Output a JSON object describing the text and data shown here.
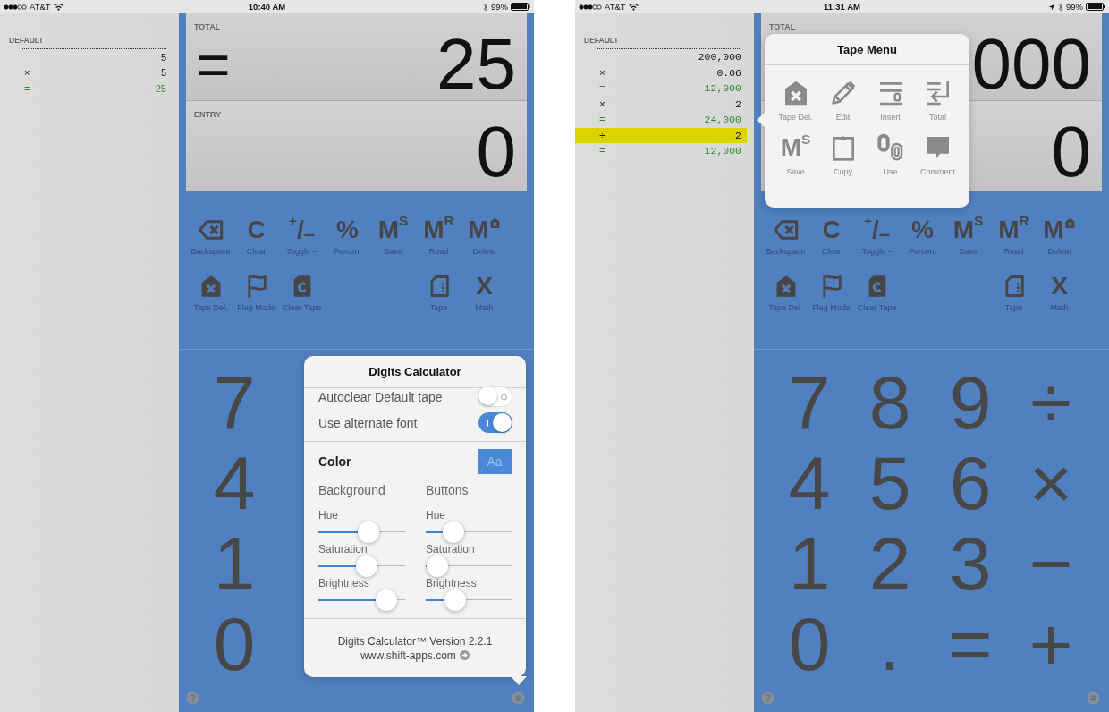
{
  "screens": [
    {
      "status_bar": {
        "carrier": "AT&T",
        "time": "10:40 AM",
        "battery": "99%",
        "location_services": false
      },
      "tape": {
        "title": "DEFAULT",
        "rows": [
          {
            "value": "5",
            "kind": "entry",
            "selected": false
          },
          {
            "operator": "×",
            "value": "5",
            "kind": "entry",
            "selected": false
          },
          {
            "operator": "=",
            "value": "25",
            "kind": "result",
            "selected": false
          }
        ]
      },
      "display": {
        "total": {
          "label": "TOTAL",
          "operator": "=",
          "value": "25"
        },
        "entry": {
          "label": "ENTRY",
          "value": "0"
        }
      },
      "function_rows": [
        [
          {
            "label": "Backspace",
            "kind": "backspace"
          },
          {
            "label": "Clear",
            "kind": "glyph",
            "glyph": "C"
          },
          {
            "label": "Toggle –",
            "kind": "glyph",
            "glyph": "$^{+}$/$_{–}$"
          },
          {
            "label": "Percent",
            "kind": "glyph",
            "glyph": "%"
          },
          {
            "label": "Save",
            "kind": "glyph",
            "glyph": "M$^{S}$"
          },
          {
            "label": "Read",
            "kind": "glyph",
            "glyph": "M$^{R}$"
          },
          {
            "label": "Delete",
            "kind": "glyph-badge",
            "glyph": "M"
          }
        ],
        [
          {
            "label": "Tape Del.",
            "kind": "tape-del"
          },
          {
            "label": "Flag Mode",
            "kind": "flag"
          },
          {
            "label": "Clear Tape",
            "kind": "clear-tape"
          },
          {
            "label": "Tape",
            "kind": "tape"
          },
          {
            "label": "Math",
            "kind": "glyph",
            "glyph": "X"
          }
        ]
      ],
      "keypad": [
        [
          "7"
        ],
        [
          "4"
        ],
        [
          "1"
        ],
        [
          "0"
        ]
      ],
      "popover": {
        "kind": "settings",
        "title": "Digits Calculator",
        "toggles": [
          {
            "label": "Autoclear Default tape",
            "on": false
          },
          {
            "label": "Use alternate font",
            "on": true
          }
        ],
        "color": {
          "title": "Color",
          "button": "Aa",
          "columns": [
            {
              "title": "Background",
              "sliders": [
                {
                  "label": "Hue",
                  "level": 0.6
                },
                {
                  "label": "Saturation",
                  "level": 0.58
                },
                {
                  "label": "Brightness",
                  "level": 0.88
                }
              ]
            },
            {
              "title": "Buttons",
              "sliders": [
                {
                  "label": "Hue",
                  "level": 0.26
                },
                {
                  "label": "Saturation",
                  "level": 0.02
                },
                {
                  "label": "Brightness",
                  "level": 0.29
                }
              ]
            }
          ]
        },
        "footer": {
          "version": "Digits Calculator™ Version 2.2.1",
          "link": "www.shift-apps.com"
        }
      }
    },
    {
      "status_bar": {
        "carrier": "AT&T",
        "time": "11:31 AM",
        "battery": "99%",
        "location_services": true
      },
      "tape": {
        "title": "DEFAULT",
        "rows": [
          {
            "value": "200,000",
            "kind": "entry",
            "selected": false
          },
          {
            "operator": "×",
            "value": "0.06",
            "kind": "entry",
            "selected": false
          },
          {
            "operator": "=",
            "value": "12,000",
            "kind": "result",
            "selected": false
          },
          {
            "operator": "×",
            "value": "2",
            "kind": "entry",
            "selected": false
          },
          {
            "operator": "=",
            "value": "24,000",
            "kind": "result",
            "selected": false
          },
          {
            "operator": "÷",
            "value": "2",
            "kind": "entry",
            "selected": true
          },
          {
            "operator": "=",
            "value": "12,000",
            "kind": "result",
            "selected": false
          }
        ]
      },
      "display": {
        "total": {
          "label": "TOTAL",
          "value": "000"
        },
        "entry": {
          "value": "0"
        }
      },
      "function_rows": [
        [
          {
            "label": "Backspace",
            "kind": "backspace"
          },
          {
            "label": "Clear",
            "kind": "glyph",
            "glyph": "C"
          },
          {
            "label": "Toggle –",
            "kind": "glyph",
            "glyph": "$^{+}$/$_{–}$"
          },
          {
            "label": "Percent",
            "kind": "glyph",
            "glyph": "%"
          },
          {
            "label": "Save",
            "kind": "glyph",
            "glyph": "M$^{S}$"
          },
          {
            "label": "Read",
            "kind": "glyph",
            "glyph": "M$^{R}$"
          },
          {
            "label": "Delete",
            "kind": "glyph-badge",
            "glyph": "M"
          }
        ],
        [
          {
            "label": "Tape Del.",
            "kind": "tape-del"
          },
          {
            "label": "Flag Mode",
            "kind": "flag"
          },
          {
            "label": "Clear Tape",
            "kind": "clear-tape"
          },
          {
            "label": "Tape",
            "kind": "tape"
          },
          {
            "label": "Math",
            "kind": "glyph",
            "glyph": "X"
          }
        ]
      ],
      "keypad": [
        [
          "7",
          "8",
          "9",
          "÷"
        ],
        [
          "4",
          "5",
          "6",
          "×"
        ],
        [
          "1",
          "2",
          "3",
          "−"
        ],
        [
          "0",
          ".",
          "=",
          "+"
        ]
      ],
      "popover": {
        "kind": "tape_menu",
        "title": "Tape Menu",
        "items": [
          {
            "label": "Tape Del.",
            "kind": "tape-del"
          },
          {
            "label": "Edit",
            "kind": "pencil"
          },
          {
            "label": "Insert",
            "kind": "insert"
          },
          {
            "label": "Total",
            "kind": "total"
          },
          {
            "label": "Save",
            "kind": "glyph",
            "glyph": "M$^{S}$"
          },
          {
            "label": "Copy",
            "kind": "clipboard"
          },
          {
            "label": "Use",
            "kind": "zeros"
          },
          {
            "label": "Comment",
            "kind": "comment"
          }
        ]
      }
    }
  ]
}
